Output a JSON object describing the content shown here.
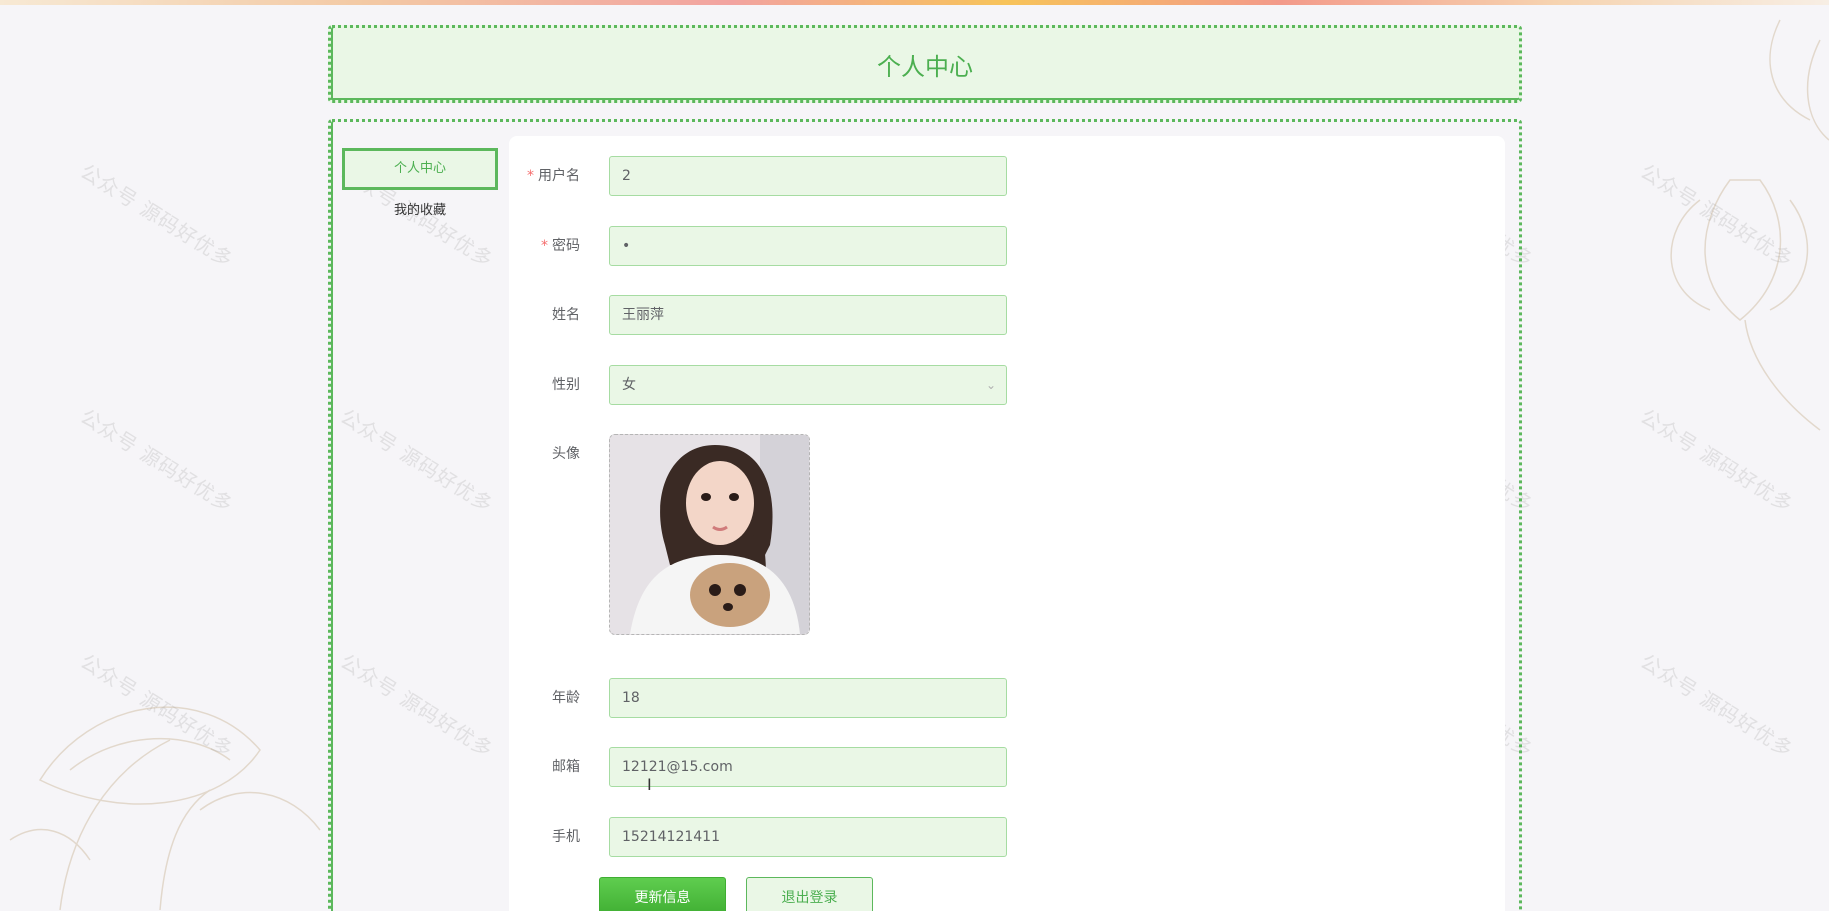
{
  "header": {
    "title": "个人中心"
  },
  "sidebar": {
    "items": [
      {
        "label": "个人中心",
        "active": true
      },
      {
        "label": "我的收藏",
        "active": false
      }
    ]
  },
  "form": {
    "username": {
      "label": "用户名",
      "value": "2",
      "required": true
    },
    "password": {
      "label": "密码",
      "value": "•",
      "required": true
    },
    "name": {
      "label": "姓名",
      "value": "王丽萍"
    },
    "gender": {
      "label": "性别",
      "value": "女"
    },
    "avatar": {
      "label": "头像"
    },
    "age": {
      "label": "年龄",
      "value": "18"
    },
    "email": {
      "label": "邮箱",
      "value": "12121@15.com"
    },
    "phone": {
      "label": "手机",
      "value": "15214121411"
    }
  },
  "actions": {
    "update_label": "更新信息",
    "logout_label": "退出登录"
  },
  "watermark_text": "公众号 源码好优多",
  "colors": {
    "accent": "#4caf50",
    "input_bg": "#eaf7e6",
    "required": "#f56c6c"
  }
}
